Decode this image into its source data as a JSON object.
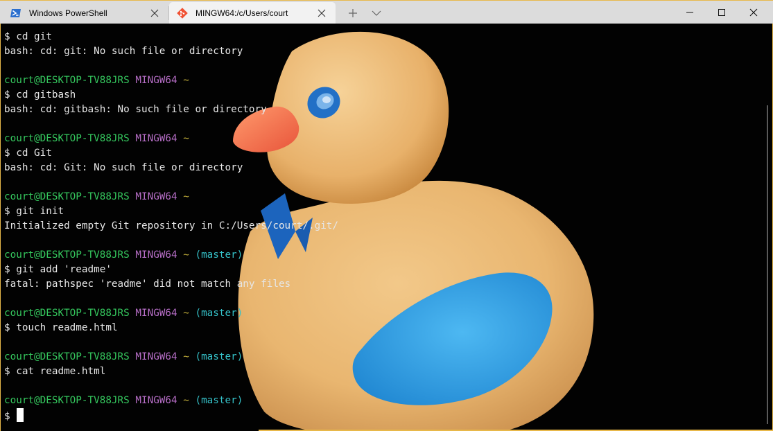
{
  "tabs": [
    {
      "title": "Windows PowerShell",
      "icon": "powershell-icon",
      "active": false
    },
    {
      "title": "MINGW64:/c/Users/court",
      "icon": "git-icon",
      "active": true
    }
  ],
  "window_controls": {
    "minimize": "minimize-icon",
    "maximize": "maximize-icon",
    "close": "close-icon"
  },
  "prompt": {
    "user_host": "court@DESKTOP-TV88JRS",
    "system": "MINGW64",
    "path": "~",
    "branch": "(master)",
    "symbol": "$"
  },
  "terminal_lines": [
    {
      "type": "cmd",
      "text": "cd git"
    },
    {
      "type": "out",
      "text": "bash: cd: git: No such file or directory"
    },
    {
      "type": "blank"
    },
    {
      "type": "prompt",
      "branch": false
    },
    {
      "type": "cmd",
      "text": "cd gitbash"
    },
    {
      "type": "out",
      "text": "bash: cd: gitbash: No such file or directory"
    },
    {
      "type": "blank"
    },
    {
      "type": "prompt",
      "branch": false
    },
    {
      "type": "cmd",
      "text": "cd Git"
    },
    {
      "type": "out",
      "text": "bash: cd: Git: No such file or directory"
    },
    {
      "type": "blank"
    },
    {
      "type": "prompt",
      "branch": false
    },
    {
      "type": "cmd",
      "text": "git init"
    },
    {
      "type": "out",
      "text": "Initialized empty Git repository in C:/Users/court/.git/"
    },
    {
      "type": "blank"
    },
    {
      "type": "prompt",
      "branch": true
    },
    {
      "type": "cmd",
      "text": "git add 'readme'"
    },
    {
      "type": "out",
      "text": "fatal: pathspec 'readme' did not match any files"
    },
    {
      "type": "blank"
    },
    {
      "type": "prompt",
      "branch": true
    },
    {
      "type": "cmd",
      "text": "touch readme.html"
    },
    {
      "type": "blank"
    },
    {
      "type": "prompt",
      "branch": true
    },
    {
      "type": "cmd",
      "text": "cat readme.html"
    },
    {
      "type": "blank"
    },
    {
      "type": "prompt",
      "branch": true
    },
    {
      "type": "input",
      "text": ""
    }
  ],
  "colors": {
    "user_host": "#35c85e",
    "system": "#b86fc8",
    "tilde": "#c9b53d",
    "branch": "#35c1c8",
    "text": "#e6e6e6",
    "background": "#020202",
    "titlebar": "#dcdcdc",
    "active_tab": "#f2f2f2",
    "accent_border": "#e8b84a"
  }
}
